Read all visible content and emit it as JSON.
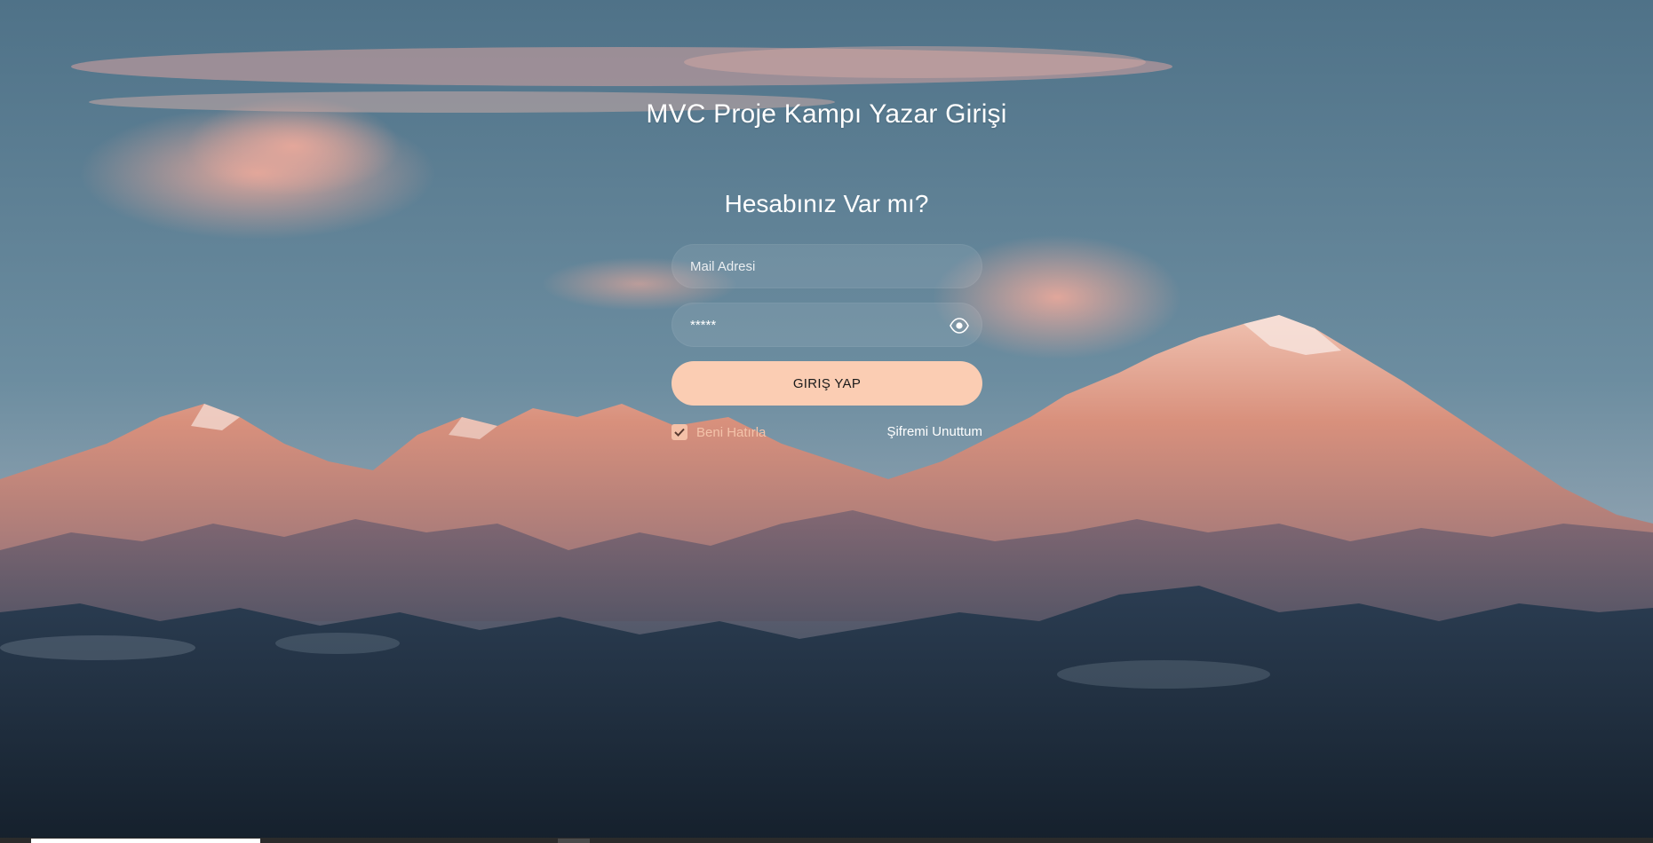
{
  "page": {
    "title": "MVC Proje Kampı Yazar Girişi"
  },
  "form": {
    "heading": "Hesabınız Var mı?",
    "email_placeholder": "Mail Adresi",
    "password_value": "*****",
    "submit_label": "GIRIŞ YAP",
    "remember_label": "Beni Hatırla",
    "remember_checked": true,
    "forgot_label": "Şifremi Unuttum"
  },
  "icons": {
    "password_toggle": "eye-icon",
    "remember_check": "check-icon"
  },
  "colors": {
    "button": "#fbcdb3",
    "checkbox": "#f4c1a8",
    "remember_text": "#f3c3aa",
    "sky": "#5a7d92",
    "mountains_lit": "#d98c7a",
    "foothills": "#1f3042"
  }
}
